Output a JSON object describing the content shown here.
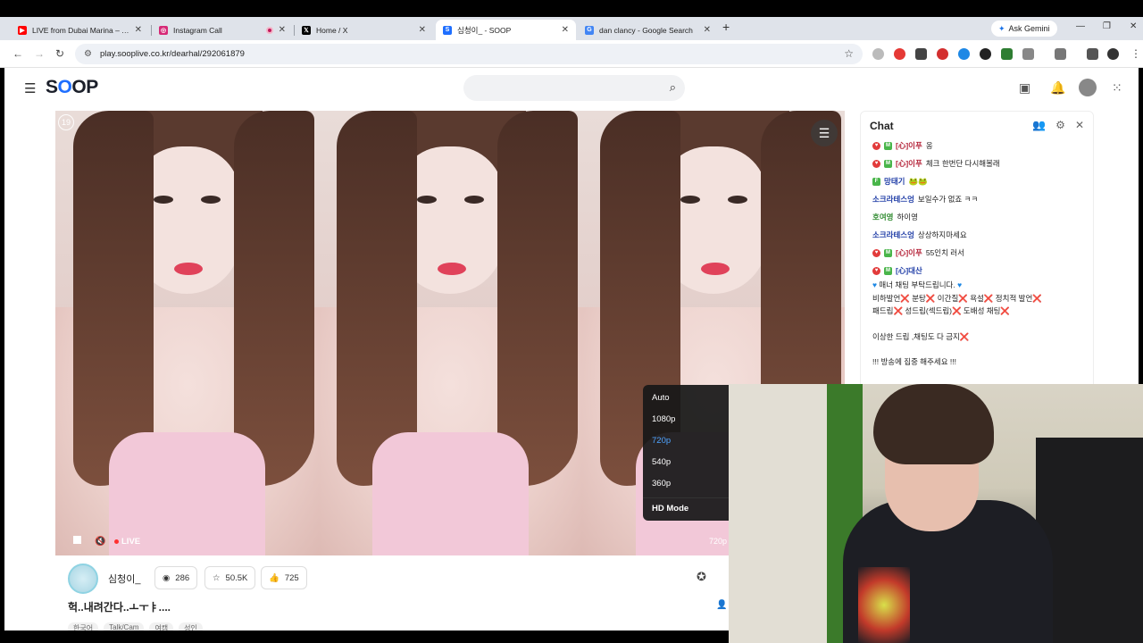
{
  "browser": {
    "tabs": [
      {
        "title": "LIVE from Dubai Marina – Tens",
        "icon": "youtube-icon",
        "color": "#ff0000"
      },
      {
        "title": "Instagram Call",
        "icon": "instagram-icon",
        "color": "#d62976"
      },
      {
        "title": "Home / X",
        "icon": "x-icon",
        "color": "#000000"
      },
      {
        "title": "심청이_ - SOOP",
        "icon": "soop-icon",
        "color": "#1f6fff"
      },
      {
        "title": "dan clancy - Google Search",
        "icon": "google-icon",
        "color": "#4285f4"
      }
    ],
    "new_tab": "+",
    "ask_gemini": "Ask Gemini",
    "url": "play.sooplive.co.kr/dearhal/292061879"
  },
  "site": {
    "logo_pre": "S",
    "logo_o": "O",
    "logo_post": "OP"
  },
  "video": {
    "age_rating": "19",
    "live_label": "LIVE",
    "quality_label": "720p",
    "quality_menu": {
      "items": [
        "Auto",
        "1080p",
        "720p",
        "540p",
        "360p"
      ],
      "selected": "720p",
      "hd_mode": "HD Mode"
    }
  },
  "broadcast": {
    "streamer_name": "심청이_",
    "viewer_count": "286",
    "favorites": "50.5K",
    "likes": "725",
    "title": "헉..내려간다..ㅗㅜㅑ....",
    "tags": [
      "한국어",
      "Talk/Cam",
      "여캠",
      "성인"
    ]
  },
  "chat": {
    "title": "Chat",
    "messages": [
      {
        "user": "[心]이푸",
        "text": "옹",
        "color": "red",
        "badges": true
      },
      {
        "user": "[心]이푸",
        "text": "체크 한번단 다시해볼래",
        "color": "red",
        "badges": true
      },
      {
        "user": "망태기",
        "text": "🐸🐸",
        "color": "blu",
        "badges": false,
        "green": true
      },
      {
        "user": "소크라테스엉",
        "text": "보일수가 없죠 ㅋㅋ",
        "color": "blu",
        "badges": false
      },
      {
        "user": "호여영",
        "text": "하이영",
        "color": "grn",
        "badges": false
      },
      {
        "user": "소크라테스엉",
        "text": "상상하지마세요",
        "color": "blu",
        "badges": false
      },
      {
        "user": "[心]이푸",
        "text": "55인치 러서",
        "color": "red",
        "badges": true
      },
      {
        "user": "[心]대산",
        "text": "",
        "color": "blu",
        "badges": true
      }
    ],
    "notice": {
      "line1": "매너 채팅 부탁드립니다.",
      "line2": "비하발언❌ 분탕❌ 이간질❌ 욕설❌ 정치적 발언❌",
      "line3": "패드립❌ 성드립(섹드립)❌ 도배성 채팅❌",
      "line4": "이상한 드립 ,채팅도 다 금지❌",
      "line5": "!!! 방송에 집중 해주세요 !!!"
    }
  }
}
